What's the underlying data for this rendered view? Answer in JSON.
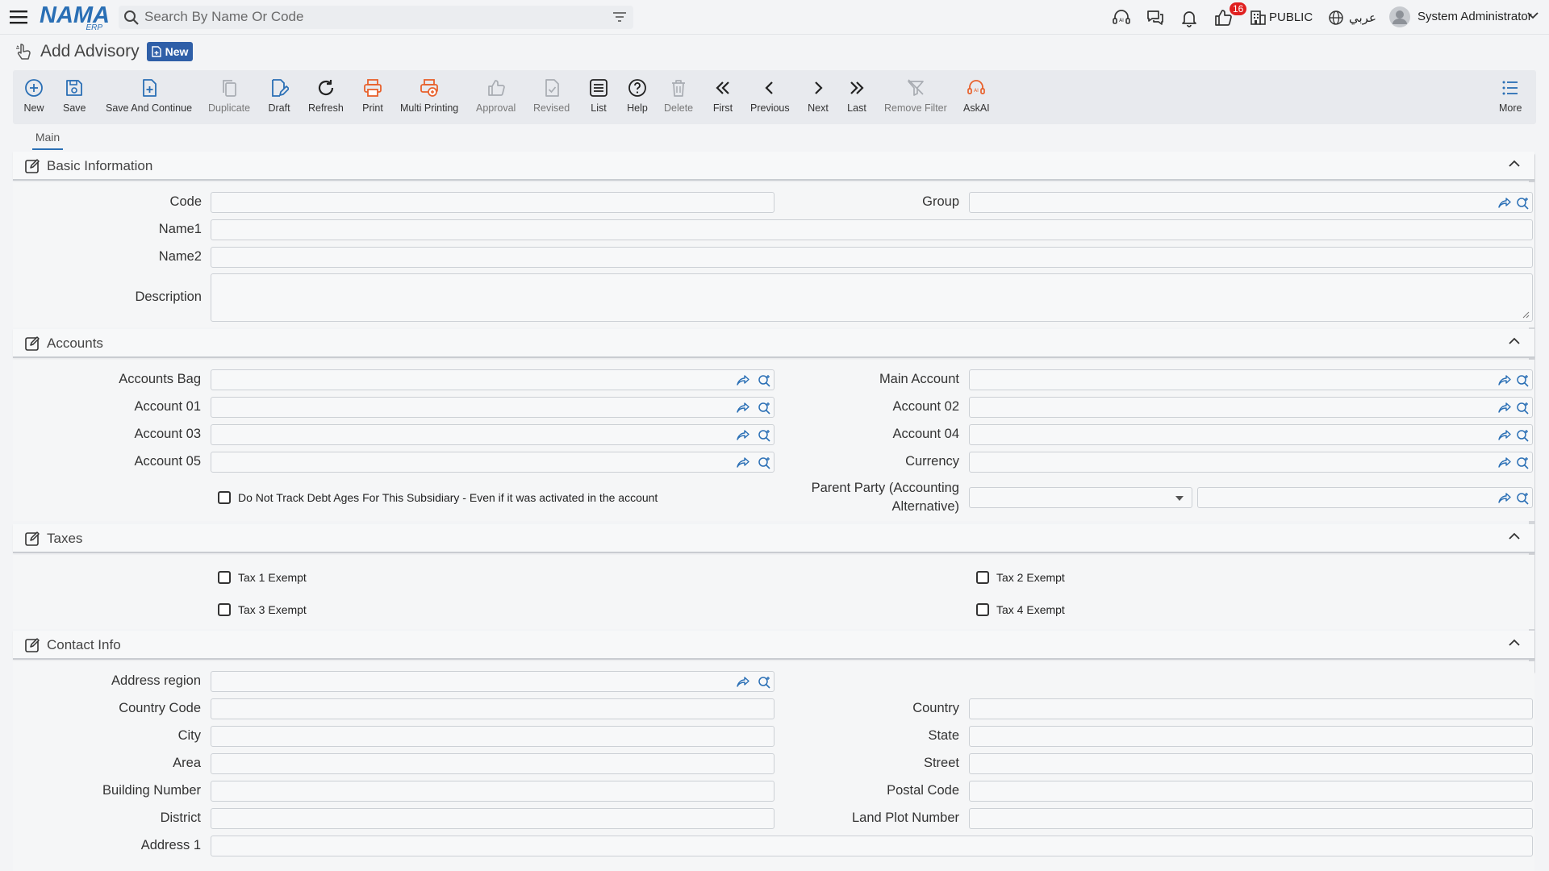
{
  "header": {
    "logo_text": "NAMA",
    "logo_sub": "ERP",
    "search_placeholder": "Search By Name Or Code",
    "notifications_count": "16",
    "branch_label": "PUBLIC",
    "language_label": "عربي",
    "user_name": "System Administrator"
  },
  "page": {
    "title": "Add Advisory",
    "status_badge": "New"
  },
  "toolbar": {
    "new": "New",
    "save": "Save",
    "save_continue": "Save And Continue",
    "duplicate": "Duplicate",
    "draft": "Draft",
    "refresh": "Refresh",
    "print": "Print",
    "multi_printing": "Multi Printing",
    "approval": "Approval",
    "revised": "Revised",
    "list": "List",
    "help": "Help",
    "delete": "Delete",
    "first": "First",
    "previous": "Previous",
    "next": "Next",
    "last": "Last",
    "remove_filter": "Remove Filter",
    "askai": "AskAI",
    "more": "More"
  },
  "tabs": {
    "main": "Main"
  },
  "sections": {
    "basic": {
      "title": "Basic Information",
      "code": "Code",
      "group": "Group",
      "name1": "Name1",
      "name2": "Name2",
      "description": "Description"
    },
    "accounts": {
      "title": "Accounts",
      "accounts_bag": "Accounts Bag",
      "main_account": "Main Account",
      "account01": "Account 01",
      "account02": "Account 02",
      "account03": "Account 03",
      "account04": "Account 04",
      "account05": "Account 05",
      "currency": "Currency",
      "debt_ages": "Do Not Track Debt Ages For This Subsidiary - Even if it was activated in the account",
      "parent_party_line1": "Parent Party (Accounting",
      "parent_party_line2": "Alternative)"
    },
    "taxes": {
      "title": "Taxes",
      "tax1": "Tax 1 Exempt",
      "tax2": "Tax 2 Exempt",
      "tax3": "Tax 3 Exempt",
      "tax4": "Tax 4 Exempt"
    },
    "contact": {
      "title": "Contact Info",
      "address_region": "Address region",
      "country_code": "Country Code",
      "country": "Country",
      "city": "City",
      "state": "State",
      "area": "Area",
      "street": "Street",
      "building_number": "Building Number",
      "postal_code": "Postal Code",
      "district": "District",
      "land_plot_number": "Land Plot Number",
      "address1": "Address 1"
    }
  },
  "colors": {
    "accent": "#2a6fb5",
    "orange": "#e8612c",
    "badge_red": "#e02020"
  }
}
